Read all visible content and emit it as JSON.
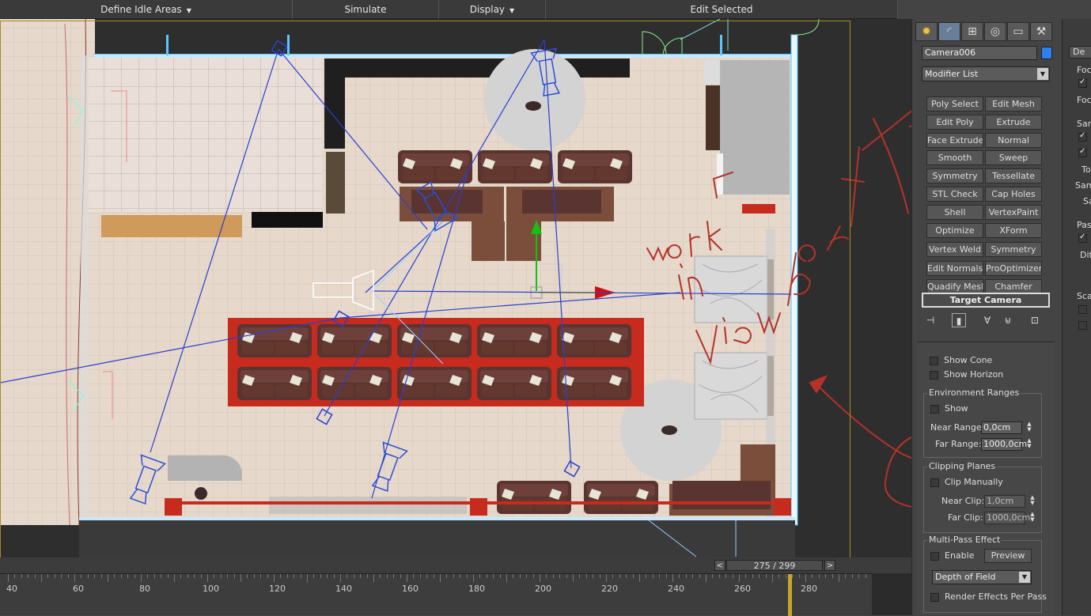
{
  "toolbar": {
    "define_idle_areas": "Define Idle Areas",
    "simulate": "Simulate",
    "display": "Display",
    "edit_selected": "Edit Selected"
  },
  "viewport": {
    "annotation": [
      "work",
      "in",
      "viewport"
    ],
    "annotation_color": "#b4322a"
  },
  "timeline": {
    "frame_counter": "275 / 299",
    "prev": "<",
    "next": ">",
    "ruler_labels": [
      "40",
      "60",
      "80",
      "100",
      "120",
      "140",
      "160",
      "180",
      "200",
      "220",
      "240",
      "260",
      "280"
    ]
  },
  "panel": {
    "tab_icons": [
      "create-icon",
      "modify-icon",
      "hierarchy-icon",
      "motion-icon",
      "display-icon",
      "utilities-icon"
    ],
    "object_name": "Camera006",
    "object_color": "#2e7ff0",
    "modifier_list": "Modifier List",
    "modifier_buttons": [
      "Poly Select",
      "Edit Mesh",
      "Edit Poly",
      "Extrude",
      "Face Extrude",
      "Normal",
      "Smooth",
      "Sweep",
      "Symmetry",
      "Tessellate",
      "STL Check",
      "Cap Holes",
      "Shell",
      "VertexPaint",
      "Optimize",
      "XForm",
      "Vertex Weld",
      "Symmetry",
      "Edit Normals",
      "ProOptimizer",
      "Quadify Mesh",
      "Chamfer"
    ],
    "stack_item": "Target Camera",
    "show_cone": "Show Cone",
    "show_horizon": "Show Horizon",
    "env_ranges": {
      "title": "Environment Ranges",
      "show": "Show",
      "near_label": "Near Range:",
      "near_value": "0,0cm",
      "far_label": "Far Range:",
      "far_value": "1000,0cm"
    },
    "clipping": {
      "title": "Clipping Planes",
      "clip_manually": "Clip Manually",
      "near_label": "Near Clip:",
      "near_value": "1,0cm",
      "far_label": "Far Clip:",
      "far_value": "1000,0cm"
    },
    "multipass": {
      "title": "Multi-Pass Effect",
      "enable": "Enable",
      "preview": "Preview",
      "effect": "Depth of Field",
      "render_effects": "Render Effects Per Pass"
    }
  },
  "panel2": {
    "header": "De",
    "labels": [
      "Foca",
      "Foca",
      "Sam",
      "Tot",
      "Samp",
      "Sa",
      "Pass",
      "Dit",
      "Scar"
    ]
  }
}
